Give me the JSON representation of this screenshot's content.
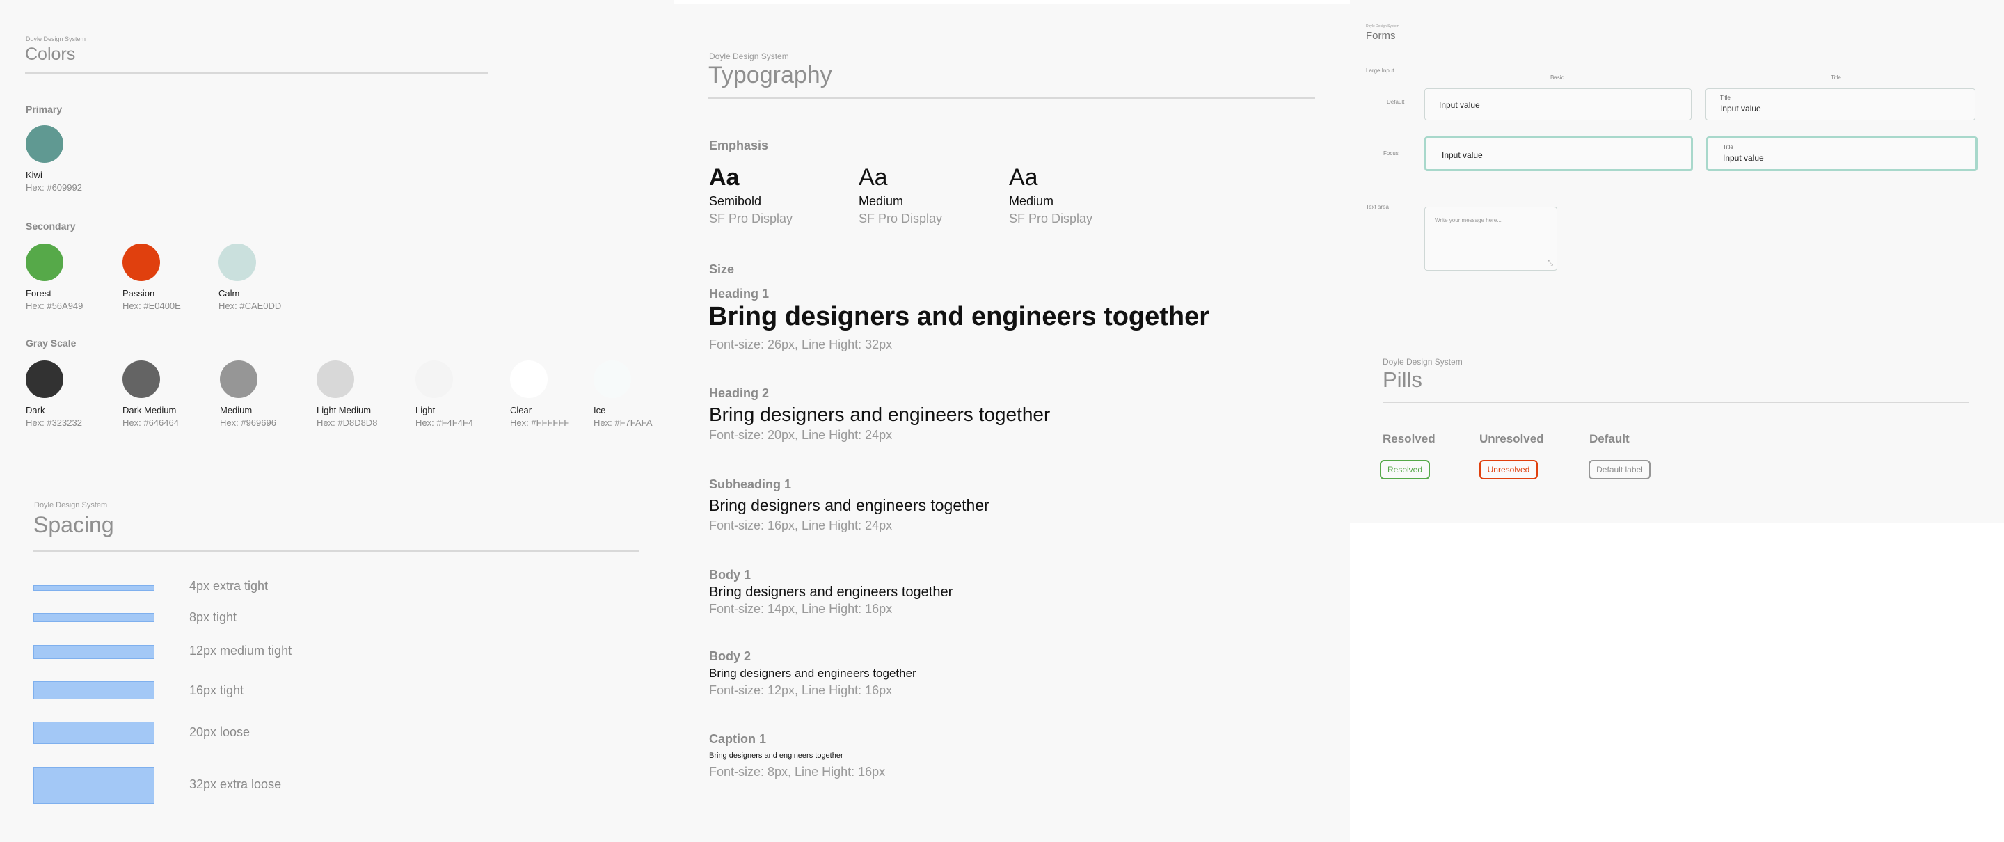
{
  "colors": {
    "system": "Doyle Design System",
    "title": "Colors",
    "primary": {
      "label": "Primary",
      "items": [
        {
          "name": "Kiwi",
          "hex": "Hex: #609992",
          "color": "#609992"
        }
      ]
    },
    "secondary": {
      "label": "Secondary",
      "items": [
        {
          "name": "Forest",
          "hex": "Hex: #56A949",
          "color": "#56A949"
        },
        {
          "name": "Passion",
          "hex": "Hex: #E0400E",
          "color": "#E0400E"
        },
        {
          "name": "Calm",
          "hex": "Hex: #CAE0DD",
          "color": "#CAE0DD"
        }
      ]
    },
    "gray": {
      "label": "Gray Scale",
      "items": [
        {
          "name": "Dark",
          "hex": "Hex: #323232",
          "color": "#323232"
        },
        {
          "name": "Dark Medium",
          "hex": "Hex: #646464",
          "color": "#646464"
        },
        {
          "name": "Medium",
          "hex": "Hex: #969696",
          "color": "#969696"
        },
        {
          "name": "Light Medium",
          "hex": "Hex: #D8D8D8",
          "color": "#D8D8D8"
        },
        {
          "name": "Light",
          "hex": "Hex: #F4F4F4",
          "color": "#F4F4F4"
        },
        {
          "name": "Clear",
          "hex": "Hex: #FFFFFF",
          "color": "#FFFFFF"
        },
        {
          "name": "Ice",
          "hex": "Hex: #F7FAFA",
          "color": "#F7FAFA"
        }
      ]
    }
  },
  "spacing": {
    "system": "Doyle Design System",
    "title": "Spacing",
    "items": [
      {
        "label": "4px extra tight"
      },
      {
        "label": "8px tight"
      },
      {
        "label": "12px medium tight"
      },
      {
        "label": "16px tight"
      },
      {
        "label": "20px loose"
      },
      {
        "label": "32px extra loose"
      }
    ]
  },
  "typography": {
    "system": "Doyle Design System",
    "title": "Typography",
    "emphasis_label": "Emphasis",
    "emphasis": [
      {
        "sample": "Aa",
        "weight": "Semibold",
        "family": "SF Pro Display"
      },
      {
        "sample": "Aa",
        "weight": "Medium",
        "family": "SF Pro Display"
      },
      {
        "sample": "Aa",
        "weight": "Medium",
        "family": "SF Pro Display"
      }
    ],
    "size_label": "Size",
    "styles": [
      {
        "label": "Heading 1",
        "sample": "Bring designers and engineers together",
        "meta": "Font-size: 26px, Line Hight: 32px"
      },
      {
        "label": "Heading 2",
        "sample": "Bring designers and engineers together",
        "meta": "Font-size: 20px, Line Hight: 24px"
      },
      {
        "label": "Subheading 1",
        "sample": "Bring designers and engineers together",
        "meta": "Font-size: 16px, Line Hight: 24px"
      },
      {
        "label": "Body 1",
        "sample": "Bring designers and engineers together",
        "meta": "Font-size: 14px, Line Hight: 16px"
      },
      {
        "label": "Body 2",
        "sample": "Bring designers and engineers together",
        "meta": "Font-size: 12px, Line Hight: 16px"
      },
      {
        "label": "Caption 1",
        "sample": "Bring designers and engineers together",
        "meta": "Font-size: 8px, Line Hight: 16px"
      }
    ]
  },
  "forms": {
    "system": "Doyle Design System",
    "title": "Forms",
    "large_input_label": "Large Input",
    "col_basic": "Basic",
    "col_title": "Title",
    "row_default": "Default",
    "row_focus": "Focus",
    "input_value": "Input value",
    "field_title": "Title",
    "textarea_label": "Text area",
    "textarea_placeholder": "Write your message here..."
  },
  "pills": {
    "system": "Doyle Design System",
    "title": "Pills",
    "items": [
      {
        "heading": "Resolved",
        "label": "Resolved",
        "color": "#56A949"
      },
      {
        "heading": "Unresolved",
        "label": "Unresolved",
        "color": "#E0400E"
      },
      {
        "heading": "Default",
        "label": "Default label",
        "color": "#969696"
      }
    ]
  }
}
